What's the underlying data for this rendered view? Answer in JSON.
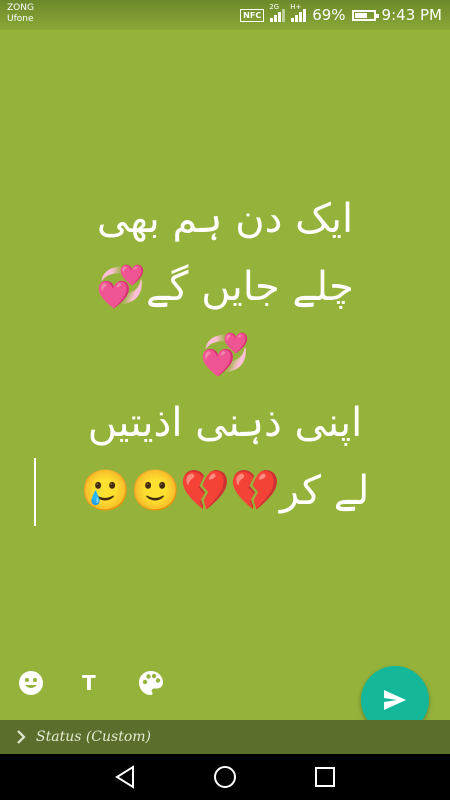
{
  "status_bar": {
    "carrier_1": "ZONG",
    "carrier_2": "Ufone",
    "nfc": "NFC",
    "network_1": "2G",
    "network_2": "H+",
    "battery_percent": "69%",
    "battery_level": 0.69,
    "time": "9:43 PM"
  },
  "message": {
    "lines": [
      "ایک دن ہم بھی",
      "چلے جایں گے💞",
      "💞",
      "اپنی ذہنی اذیتیں",
      "لے کر💔💔🙂🥲"
    ]
  },
  "tools": {
    "emoji_icon": "emoji-icon",
    "text_icon": "T",
    "palette_icon": "palette-icon",
    "send_icon": "send-icon"
  },
  "status_strip": {
    "label": "Status (Custom)"
  },
  "colors": {
    "background": "#95b33b",
    "send_button": "#14b79a",
    "status_strip": "#5b6e2c"
  }
}
